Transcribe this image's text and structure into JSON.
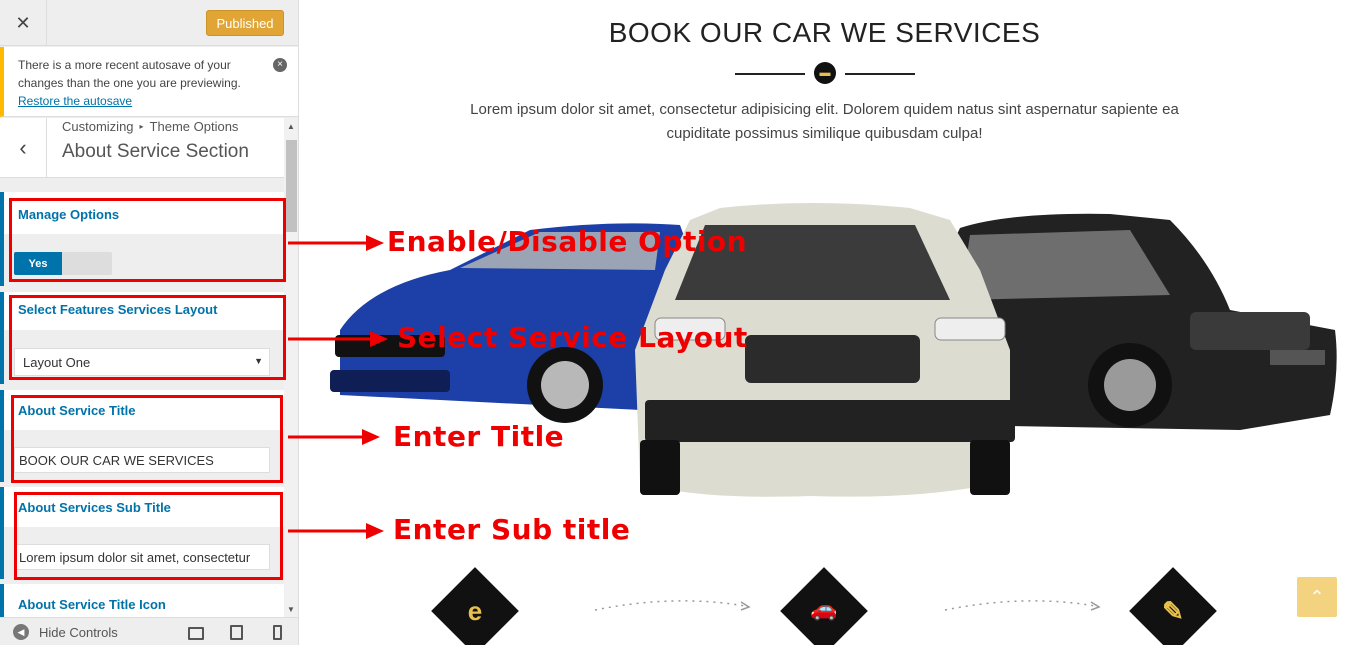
{
  "sidebar": {
    "close_glyph": "✕",
    "publish_label": "Published",
    "notice": {
      "text": "There is a more recent autosave of your changes than the one you are previewing.",
      "link": "Restore the autosave",
      "dismiss_glyph": "×"
    },
    "breadcrumb": {
      "root": "Customizing",
      "separator": "▸",
      "parent": "Theme Options"
    },
    "section_title": "About Service Section",
    "back_glyph": "‹",
    "controls": {
      "manage_options": {
        "label": "Manage Options",
        "toggle_on_label": "Yes"
      },
      "layout": {
        "label": "Select Features Services Layout",
        "value": "Layout One"
      },
      "title": {
        "label": "About Service Title",
        "value": "BOOK OUR CAR WE SERVICES"
      },
      "subtitle": {
        "label": "About Services Sub Title",
        "value": "Lorem ipsum dolor sit amet, consectetur"
      },
      "title_icon": {
        "label": "About Service Title Icon"
      }
    },
    "footer": {
      "hide_controls": "Hide Controls"
    }
  },
  "preview": {
    "title": "BOOK OUR CAR WE SERVICES",
    "subtitle": "Lorem ipsum dolor sit amet, consectetur adipisicing elit. Dolorem quidem natus sint aspernatur sapiente ea cupiditate possimus similique quibusdam culpa!",
    "services": [
      {
        "icon": "internet-explorer-icon",
        "glyph": "e"
      },
      {
        "icon": "car-icon",
        "glyph": "🚗"
      },
      {
        "icon": "edit-icon",
        "glyph": "✎"
      }
    ],
    "to_top_glyph": "⌃"
  },
  "annotations": {
    "enable_disable": "Enable/Disable Option",
    "select_layout": "Select Service Layout",
    "enter_title": "Enter Title",
    "enter_subtitle": "Enter Sub title"
  },
  "colors": {
    "accent": "#0073aa",
    "publish": "#e0a535",
    "annotation": "#e00000",
    "icon_gold": "#e8c14d"
  }
}
